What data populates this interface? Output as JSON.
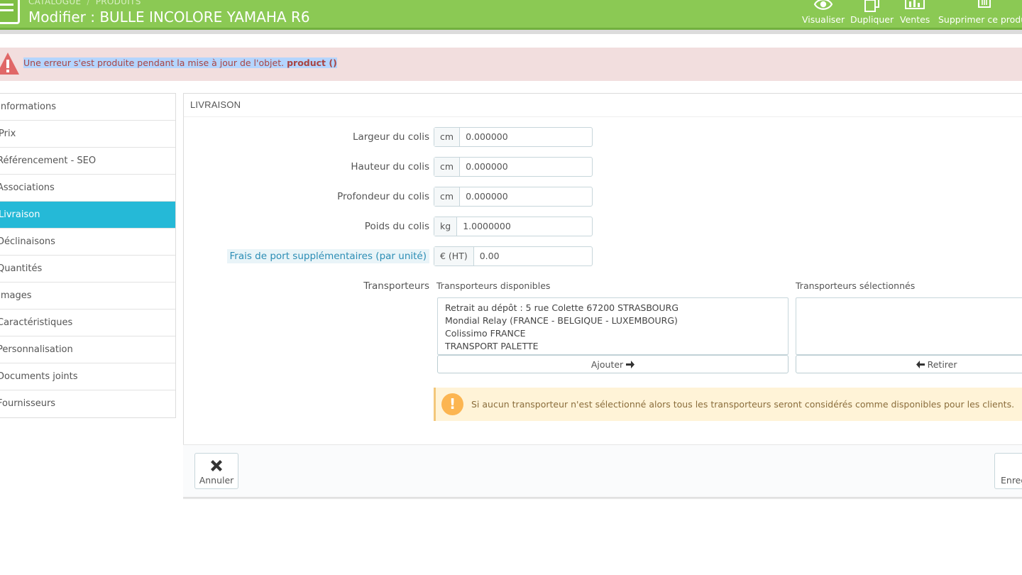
{
  "header": {
    "breadcrumb": [
      "CATALOGUE",
      "PRODUITS"
    ],
    "title": "Modifier : BULLE INCOLORE YAMAHA R6",
    "toolbar": [
      {
        "label": "Visualiser",
        "icon": "eye-icon"
      },
      {
        "label": "Dupliquer",
        "icon": "copy-icon"
      },
      {
        "label": "Ventes",
        "icon": "bar-chart-icon"
      },
      {
        "label": "Supprimer ce produit",
        "icon": "trash-icon"
      }
    ],
    "color": "#8bc954"
  },
  "error": {
    "message": "Une erreur s'est produite pendant la mise à jour de l'objet.",
    "object": "product ()"
  },
  "sidebar": {
    "items": [
      {
        "label": "Informations"
      },
      {
        "label": "Prix"
      },
      {
        "label": "Référencement - SEO"
      },
      {
        "label": "Associations"
      },
      {
        "label": "Livraison",
        "active": true
      },
      {
        "label": "Déclinaisons"
      },
      {
        "label": "Quantités"
      },
      {
        "label": "Images"
      },
      {
        "label": "Caractéristiques"
      },
      {
        "label": "Personnalisation"
      },
      {
        "label": "Documents joints"
      },
      {
        "label": "Fournisseurs"
      }
    ],
    "active_color": "#25b9d7"
  },
  "panel": {
    "heading": "LIVRAISON",
    "fields": {
      "width": {
        "label": "Largeur du colis",
        "unit": "cm",
        "value": "0.000000"
      },
      "height": {
        "label": "Hauteur du colis",
        "unit": "cm",
        "value": "0.000000"
      },
      "depth": {
        "label": "Profondeur du colis",
        "unit": "cm",
        "value": "0.000000"
      },
      "weight": {
        "label": "Poids du colis",
        "unit": "kg",
        "value": "1.0000000"
      },
      "shipping": {
        "label": "Frais de port supplémentaires (par unité)",
        "unit": "€ (HT)",
        "value": "0.00"
      }
    },
    "carriers": {
      "label": "Transporteurs",
      "available_title": "Transporteurs disponibles",
      "selected_title": "Transporteurs sélectionnés",
      "available": [
        "Retrait au dépôt : 5 rue Colette 67200 STRASBOURG",
        "Mondial Relay (FRANCE - BELGIQUE - LUXEMBOURG)",
        "Colissimo FRANCE",
        "TRANSPORT PALETTE"
      ],
      "add_label": "Ajouter",
      "remove_label": "Retirer"
    },
    "warning": "Si aucun transporteur n'est sélectionné alors tous les transporteurs seront considérés comme disponibles pour les clients."
  },
  "footer": {
    "cancel_label": "Annuler",
    "save_label": "Enreg"
  }
}
